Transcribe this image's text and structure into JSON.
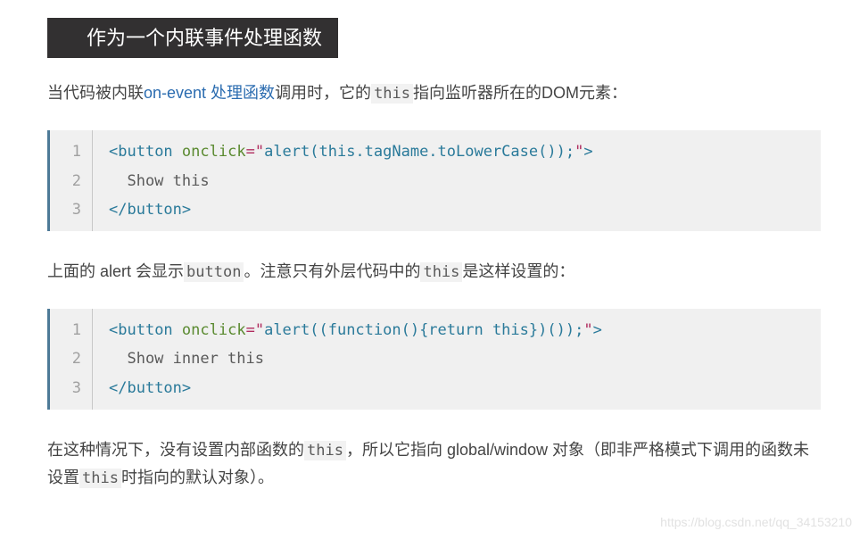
{
  "heading": "作为一个内联事件处理函数",
  "para1": {
    "pre": "当代码被内联",
    "link_text": "on-event 处理函数",
    "post_before_code": "调用时，它的",
    "inline_code": "this",
    "post_after_code": "指向监听器所在的DOM元素："
  },
  "code1": {
    "lines": [
      "1",
      "2",
      "3"
    ],
    "l1": {
      "open": "<",
      "tag": "button",
      "attr": "onclick",
      "eq": "=",
      "qo": "\"",
      "str": "alert(this.tagName.toLowerCase());",
      "qc": "\"",
      "close": ">"
    },
    "l2": "  Show this",
    "l3": {
      "open": "</",
      "tag": "button",
      "close": ">"
    }
  },
  "para2": {
    "pre": "上面的 alert 会显示",
    "inline_code1": "button",
    "mid": "。注意只有外层代码中的",
    "inline_code2": "this",
    "post": "是这样设置的："
  },
  "code2": {
    "lines": [
      "1",
      "2",
      "3"
    ],
    "l1": {
      "open": "<",
      "tag": "button",
      "attr": "onclick",
      "eq": "=",
      "qo": "\"",
      "str": "alert((function(){return this})());",
      "qc": "\"",
      "close": ">"
    },
    "l2": "  Show inner this",
    "l3": {
      "open": "</",
      "tag": "button",
      "close": ">"
    }
  },
  "para3": {
    "pre": "在这种情况下，没有设置内部函数的",
    "inline_code1": "this",
    "mid": "，所以它指向 global/window 对象（即非严格模式下调用的函数未设置",
    "inline_code2": "this",
    "post": "时指向的默认对象）。"
  },
  "watermark": "https://blog.csdn.net/qq_34153210"
}
